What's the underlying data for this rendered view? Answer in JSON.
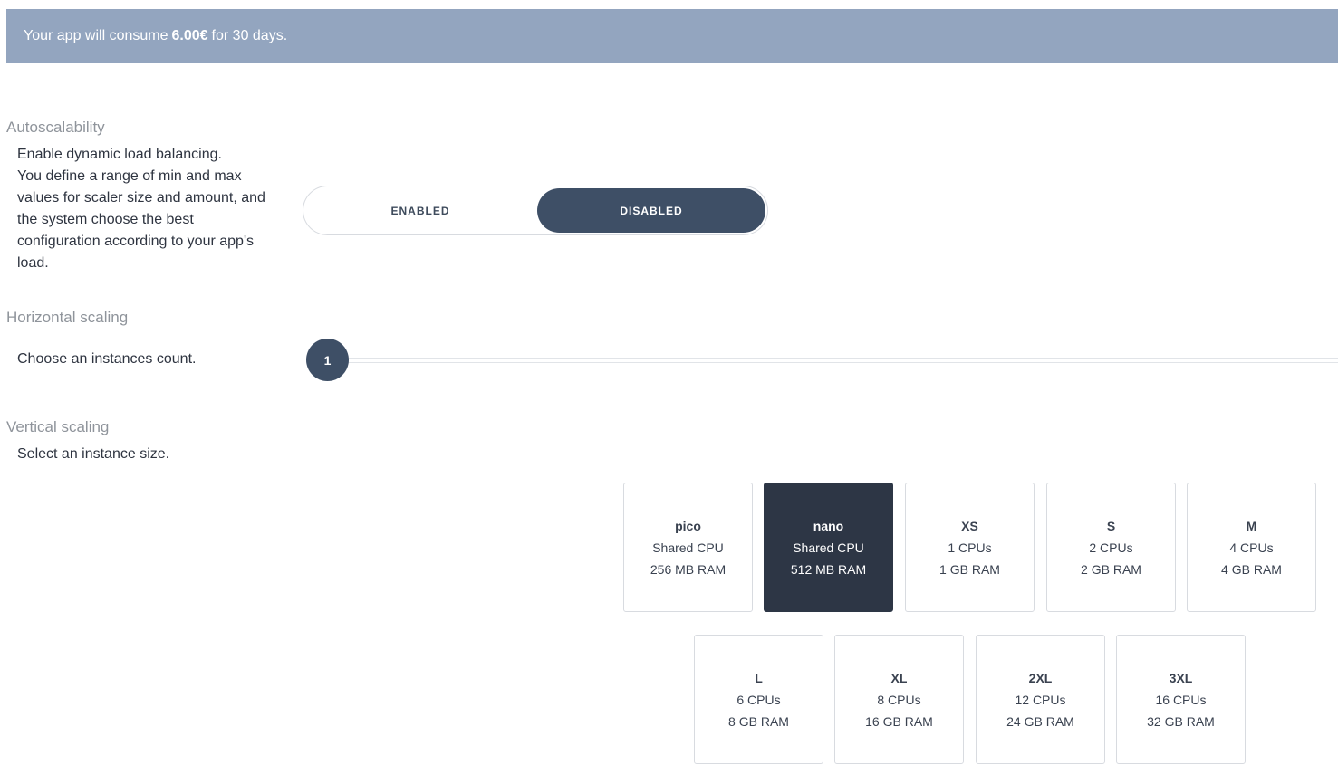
{
  "banner": {
    "prefix": "Your app will consume",
    "amount": "6.00€",
    "suffix": "for 30 days."
  },
  "autoscalability": {
    "title": "Autoscalability",
    "description_lines": [
      "Enable dynamic load balancing.",
      "You define a range of min and max",
      "values for scaler size and amount, and",
      "the system choose the best",
      "configuration according to your app's",
      "load."
    ],
    "toggle": {
      "enabled_label": "ENABLED",
      "disabled_label": "DISABLED",
      "selected": "DISABLED"
    }
  },
  "horizontal": {
    "title": "Horizontal scaling",
    "description": "Choose an instances count.",
    "instances_value": "1"
  },
  "vertical": {
    "title": "Vertical scaling",
    "description": "Select an instance size.",
    "selected": "nano",
    "sizes": [
      {
        "name": "pico",
        "cpu": "Shared CPU",
        "ram": "256 MB RAM"
      },
      {
        "name": "nano",
        "cpu": "Shared CPU",
        "ram": "512 MB RAM"
      },
      {
        "name": "XS",
        "cpu": "1 CPUs",
        "ram": "1 GB RAM"
      },
      {
        "name": "S",
        "cpu": "2 CPUs",
        "ram": "2 GB RAM"
      },
      {
        "name": "M",
        "cpu": "4 CPUs",
        "ram": "4 GB RAM"
      },
      {
        "name": "L",
        "cpu": "6 CPUs",
        "ram": "8 GB RAM"
      },
      {
        "name": "XL",
        "cpu": "8 CPUs",
        "ram": "16 GB RAM"
      },
      {
        "name": "2XL",
        "cpu": "12 CPUs",
        "ram": "24 GB RAM"
      },
      {
        "name": "3XL",
        "cpu": "16 CPUs",
        "ram": "32 GB RAM"
      }
    ]
  }
}
